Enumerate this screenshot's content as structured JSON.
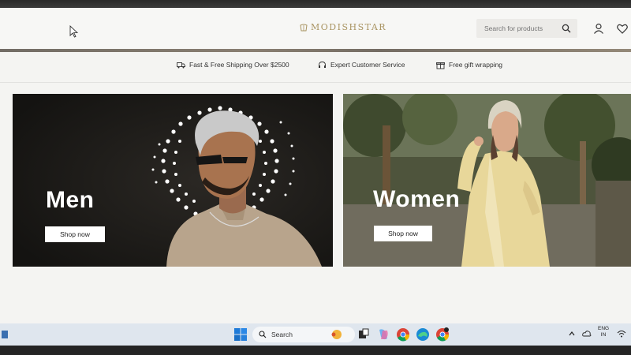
{
  "site": {
    "logo_text": "MODISHSTAR",
    "search_placeholder": "Search for products"
  },
  "benefits": [
    {
      "label": "Fast & Free Shipping Over $2500",
      "icon": "delivery-truck-icon"
    },
    {
      "label": "Expert Customer Service",
      "icon": "headset-icon"
    },
    {
      "label": "Free gift wrapping",
      "icon": "gift-icon"
    }
  ],
  "banners": [
    {
      "title": "Men",
      "button_label": "Shop now"
    },
    {
      "title": "Women",
      "button_label": "Shop now"
    }
  ],
  "taskbar": {
    "search_label": "Search",
    "language": "ENG",
    "region": "IN"
  },
  "colors": {
    "brand_gold": "#a99462",
    "men_banner_bg": "#1c1a17",
    "taskbar_bg": "#dfe6ee"
  }
}
